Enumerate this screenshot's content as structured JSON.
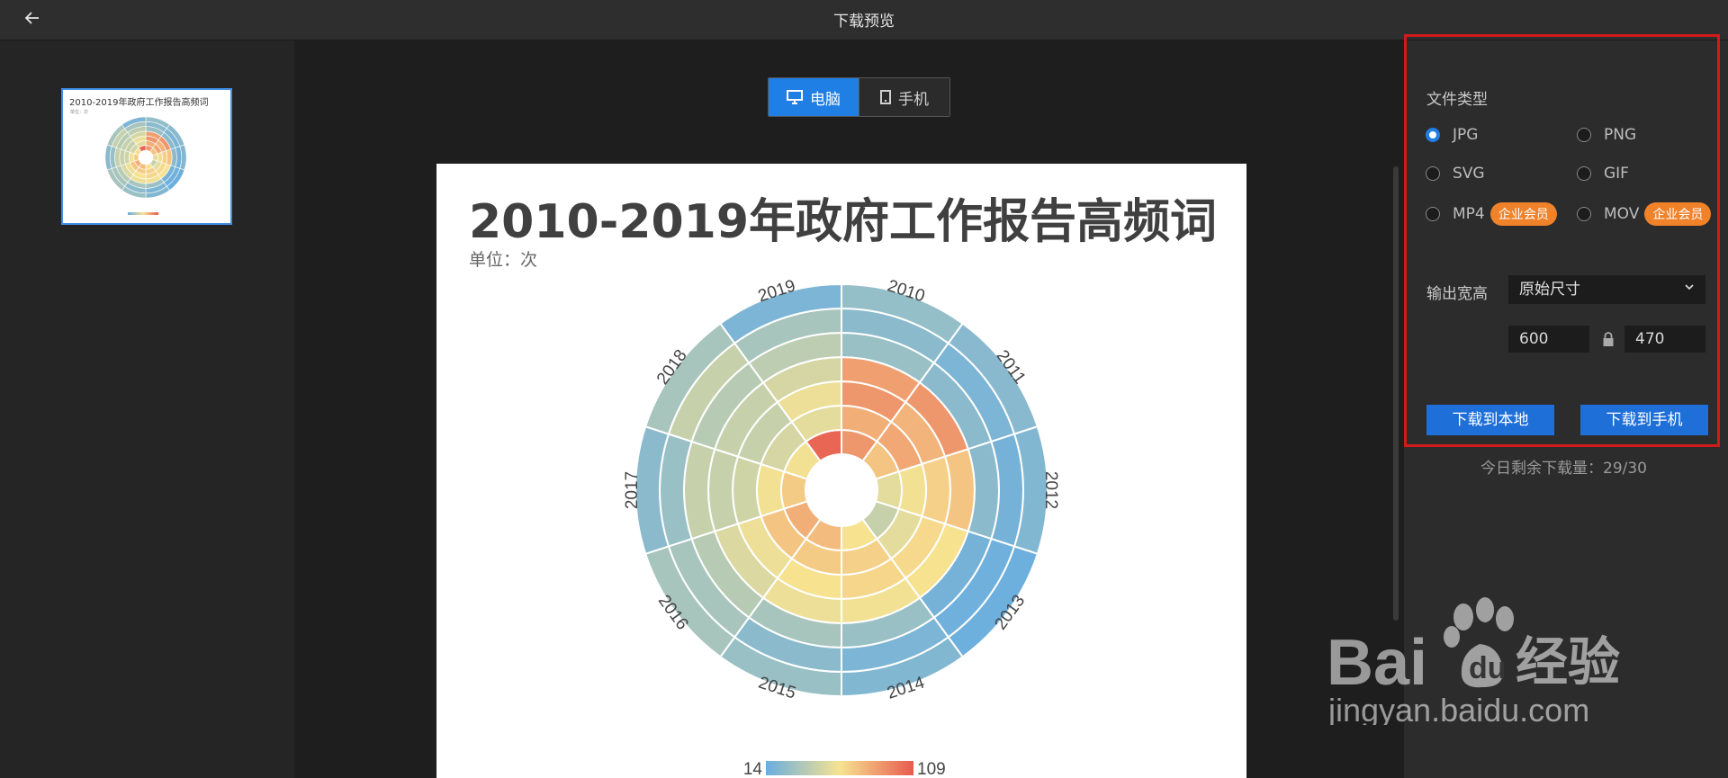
{
  "header": {
    "title": "下载预览",
    "back_icon": "arrow-left-icon"
  },
  "thumbnail": {
    "title": "2010-2019年政府工作报告高频词",
    "subtitle": "单位：次"
  },
  "device_toggle": {
    "computer_label": "电脑",
    "phone_label": "手机",
    "selected": "电脑"
  },
  "chart": {
    "title": "2010-2019年政府工作报告高频词",
    "unit": "单位：次",
    "legend_min": "14",
    "legend_max": "109"
  },
  "chart_data": {
    "type": "heatmap",
    "title": "2010-2019年政府工作报告高频词",
    "subtitle": "单位：次",
    "categories": [
      "2010",
      "2011",
      "2012",
      "2013",
      "2014",
      "2015",
      "2016",
      "2017",
      "2018",
      "2019"
    ],
    "color_scale": {
      "min": 14,
      "max": 109
    },
    "rings_inner_to_outer": [
      [
        88,
        72,
        55,
        45,
        62,
        75,
        80,
        70,
        60,
        105
      ],
      [
        80,
        82,
        60,
        55,
        68,
        70,
        72,
        60,
        50,
        55
      ],
      [
        88,
        78,
        68,
        65,
        66,
        62,
        58,
        48,
        45,
        58
      ],
      [
        85,
        88,
        72,
        62,
        60,
        58,
        52,
        45,
        45,
        50
      ],
      [
        30,
        25,
        25,
        18,
        30,
        35,
        40,
        45,
        40,
        42
      ],
      [
        25,
        20,
        18,
        16,
        20,
        25,
        35,
        30,
        45,
        35
      ],
      [
        28,
        24,
        22,
        15,
        22,
        30,
        35,
        25,
        35,
        20
      ]
    ]
  },
  "settings": {
    "file_type_label": "文件类型",
    "file_types": [
      {
        "label": "JPG",
        "checked": true
      },
      {
        "label": "PNG",
        "checked": false
      },
      {
        "label": "SVG",
        "checked": false
      },
      {
        "label": "GIF",
        "checked": false
      },
      {
        "label": "MP4",
        "checked": false,
        "badge": "企业会员"
      },
      {
        "label": "MOV",
        "checked": false,
        "badge": "企业会员"
      }
    ],
    "output_size_label": "输出宽高",
    "size_option": "原始尺寸",
    "width": "600",
    "height": "470",
    "download_local": "下载到本地",
    "download_phone": "下载到手机",
    "remaining": "今日剩余下载量：29/30"
  },
  "watermark": {
    "brand": "Baidu经验",
    "url": "jingyan.baidu.com"
  },
  "colors": {
    "accent": "#1f7fe5",
    "badge": "#f0822a",
    "highlight_box": "#d11b1b"
  }
}
